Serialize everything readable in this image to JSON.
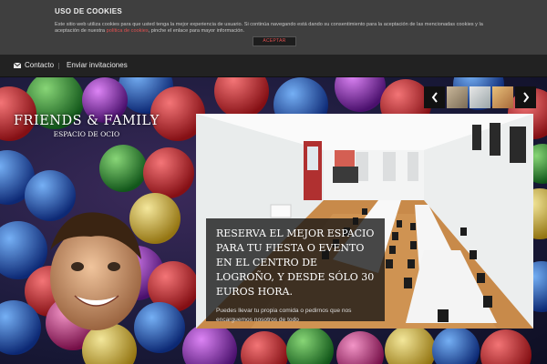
{
  "cookie": {
    "title": "USO DE COOKIES",
    "text_before": "Este sitio web utiliza cookies para que usted tenga la mejor experiencia de usuario. Si continúa navegando está dando su consentimiento para la aceptación de las mencionadas cookies y la aceptación de nuestra ",
    "link": "política de cookies",
    "text_after": ", pinche el enlace para mayor información.",
    "accept_label": "ACEPTAR",
    "link_color": "#e05050"
  },
  "nav": {
    "contact_label": "Contacto",
    "contact_icon": "mail-icon",
    "invites_label": "Enviar invitaciones"
  },
  "brand": {
    "name": "FRIENDS & FAMILY",
    "tagline": "ESPACIO DE OCIO"
  },
  "slider": {
    "prev_icon": "chevron-left-icon",
    "next_icon": "chevron-right-icon"
  },
  "caption": {
    "title": "RESERVA EL MEJOR ESPACIO PARA TU FIESTA O EVENTO EN EL CENTRO DE LOGROÑO, Y DESDE SÓLO 30 EUROS HORA.",
    "text": "Puedes llevar tu propia comida o pedirnos que nos encarguemos nosotros de todo"
  }
}
